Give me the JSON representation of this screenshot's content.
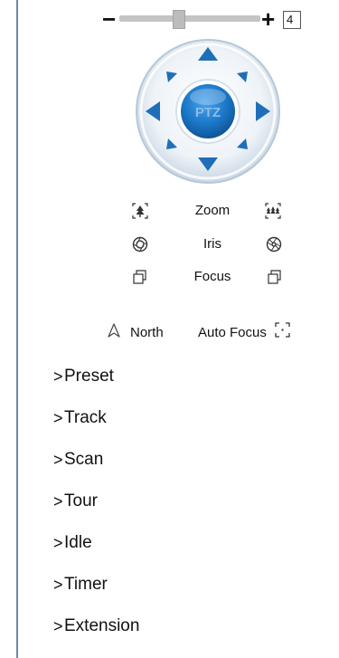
{
  "speed": {
    "minus_label": "−",
    "plus_label": "+",
    "value": "4",
    "slider_level": 0.42
  },
  "ptz": {
    "center_label": "PTZ",
    "icons": {
      "up": "arrow-up-icon",
      "down": "arrow-down-icon",
      "left": "arrow-left-icon",
      "right": "arrow-right-icon",
      "up_left": "arrow-up-left-icon",
      "up_right": "arrow-up-right-icon",
      "down_left": "arrow-down-left-icon",
      "down_right": "arrow-down-right-icon"
    },
    "colors": {
      "arrow": "#1e6fb8",
      "ring": "#dfe8f1",
      "center": "#1b78c9",
      "center_text": "#7fb3e0"
    }
  },
  "controls": {
    "zoom": {
      "label": "Zoom",
      "left_icon": "zoom-out-icon",
      "right_icon": "zoom-in-icon"
    },
    "iris": {
      "label": "Iris",
      "left_icon": "iris-open-icon",
      "right_icon": "iris-close-icon"
    },
    "focus": {
      "label": "Focus",
      "left_icon": "focus-near-icon",
      "right_icon": "focus-far-icon"
    }
  },
  "north": {
    "label": "North",
    "icon": "north-icon"
  },
  "auto_focus": {
    "label": "Auto Focus",
    "icon": "auto-focus-icon"
  },
  "menu": {
    "items": [
      {
        "label": "Preset"
      },
      {
        "label": "Track"
      },
      {
        "label": "Scan"
      },
      {
        "label": "Tour"
      },
      {
        "label": "Idle"
      },
      {
        "label": "Timer"
      },
      {
        "label": "Extension"
      }
    ],
    "chevron": ">"
  },
  "colors": {
    "divider": "#6f88a3",
    "text": "#111111"
  }
}
